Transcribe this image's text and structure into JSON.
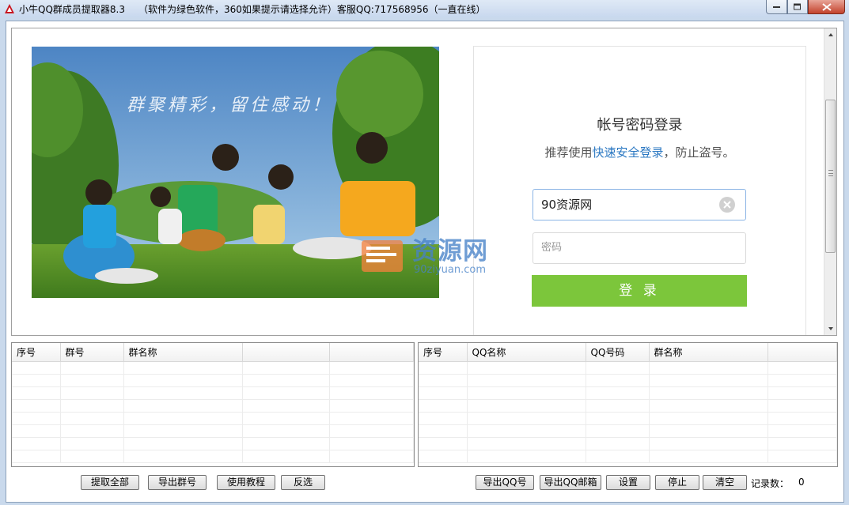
{
  "window": {
    "title": "小牛QQ群成员提取器8.3",
    "note": "（软件为绿色软件，360如果提示请选择允许）客服QQ:717568956（一直在线）"
  },
  "photo": {
    "slogan": "群聚精彩，留住感动！"
  },
  "login": {
    "title": "帐号密码登录",
    "tip_prefix": "推荐使用",
    "tip_link": "快速安全登录",
    "tip_suffix": "，防止盗号。",
    "account_value": "90资源网",
    "password_placeholder": "密码",
    "login_label": "登 录"
  },
  "watermark": {
    "name": "资源网",
    "domain": "90ziyuan.com"
  },
  "left_table": {
    "columns": [
      "序号",
      "群号",
      "群名称",
      "",
      ""
    ]
  },
  "right_table": {
    "columns": [
      "序号",
      "QQ名称",
      "QQ号码",
      "群名称",
      ""
    ]
  },
  "buttons": {
    "extract_all": "提取全部",
    "export_groups": "导出群号",
    "tutorial": "使用教程",
    "invert": "反选",
    "export_qq": "导出QQ号",
    "export_email": "导出QQ邮箱",
    "settings": "设置",
    "stop": "停止",
    "clear": "清空"
  },
  "status": {
    "count_label": "记录数：",
    "count_value": "0"
  }
}
